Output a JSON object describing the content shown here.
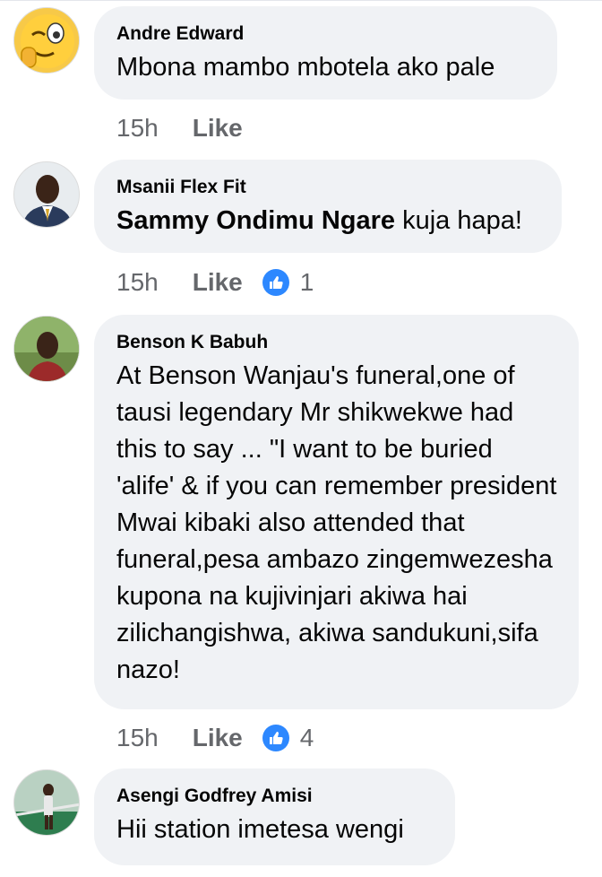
{
  "comments": [
    {
      "author": "Andre Edward",
      "mention": "",
      "text": "Mbona mambo mbotela ako pale",
      "time": "15h",
      "like_label": "Like",
      "reaction_count": ""
    },
    {
      "author": "Msanii Flex Fit",
      "mention": "Sammy Ondimu Ngare",
      "text": " kuja hapa!",
      "time": "15h",
      "like_label": "Like",
      "reaction_count": "1"
    },
    {
      "author": "Benson K Babuh",
      "mention": "",
      "text": "At Benson Wanjau's funeral,one of tausi legendary Mr shikwekwe had this to say ... \"I want to be buried 'alife'  & if you can remember president Mwai kibaki also attended that funeral,pesa ambazo zingemwezesha kupona na kujivinjari akiwa hai zilichangishwa, akiwa sandukuni,sifa nazo!",
      "time": "15h",
      "like_label": "Like",
      "reaction_count": "4"
    },
    {
      "author": "Asengi Godfrey Amisi",
      "mention": "",
      "text": "Hii station imetesa wengi",
      "time": "",
      "like_label": "",
      "reaction_count": ""
    }
  ],
  "colors": {
    "bubble": "#f0f2f5",
    "meta_text": "#65676b",
    "like_reaction": "#2d88ff"
  },
  "icons": {
    "avatar_1": "winking-emoji-avatar",
    "like_reaction": "thumbs-up-icon"
  }
}
